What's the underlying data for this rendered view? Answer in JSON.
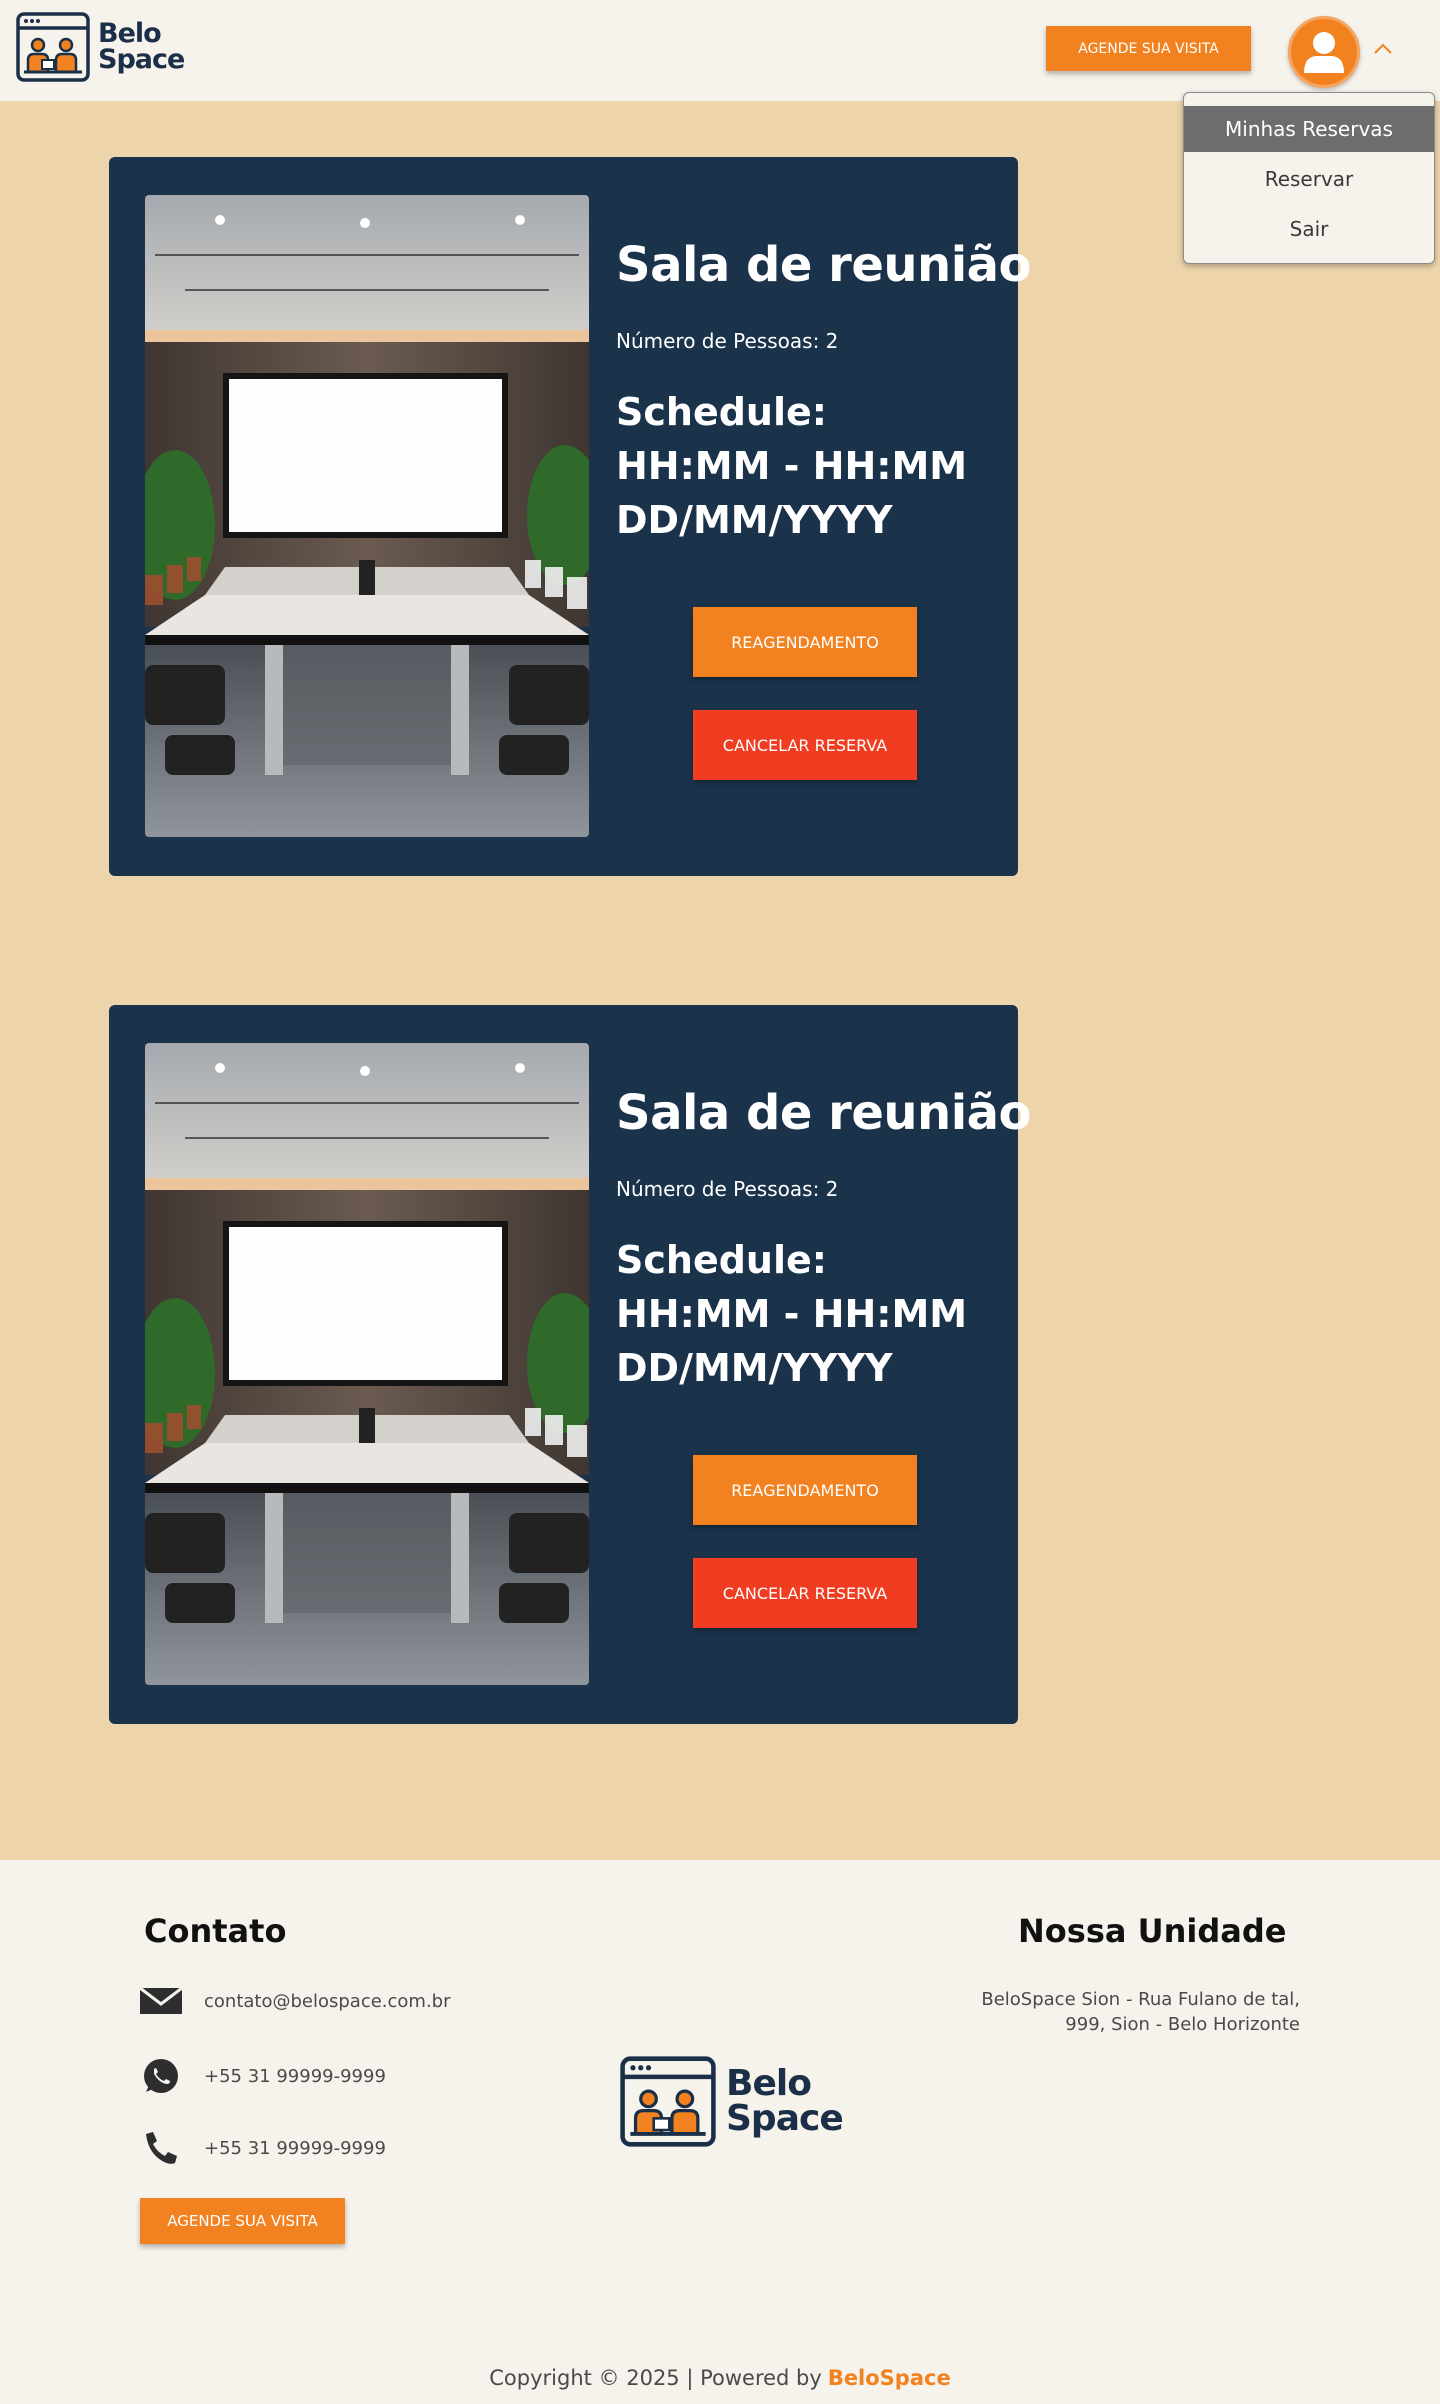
{
  "brand": {
    "name_line1": "Belo",
    "name_line2": "Space",
    "accent_color": "#f28220",
    "navy_color": "#1b324b",
    "red_color": "#f03d22",
    "main_bg_color": "#edd4ab"
  },
  "header": {
    "cta_label": "AGENDE SUA VISITA",
    "avatar_icon": "user-icon",
    "toggle_icon": "chevron-up-icon"
  },
  "user_menu": {
    "items": [
      {
        "label": "Minhas Reservas",
        "active": true
      },
      {
        "label": "Reservar",
        "active": false
      },
      {
        "label": "Sair",
        "active": false
      }
    ]
  },
  "reservations": [
    {
      "title": "Sala de reunião",
      "people": "Número de Pessoas: 2",
      "schedule_label": "Schedule:",
      "time": "HH:MM - HH:MM",
      "date": "DD/MM/YYYY",
      "reschedule_label": "REAGENDAMENTO",
      "cancel_label": "CANCELAR RESERVA"
    },
    {
      "title": "Sala de reunião",
      "people": "Número de Pessoas: 2",
      "schedule_label": "Schedule:",
      "time": "HH:MM - HH:MM",
      "date": "DD/MM/YYYY",
      "reschedule_label": "REAGENDAMENTO",
      "cancel_label": "CANCELAR RESERVA"
    }
  ],
  "footer": {
    "contact_heading": "Contato",
    "email": "contato@belospace.com.br",
    "whatsapp": "+55 31 99999-9999",
    "phone": "+55 31 99999-9999",
    "cta_label": "AGENDE SUA VISITA",
    "unit_heading": "Nossa Unidade",
    "address_line1": "BeloSpace Sion - Rua Fulano de tal,",
    "address_line2": "999, Sion - Belo Horizonte",
    "copyright_prefix": "Copyright © 2025 | Powered by",
    "copyright_brand": "BeloSpace"
  }
}
